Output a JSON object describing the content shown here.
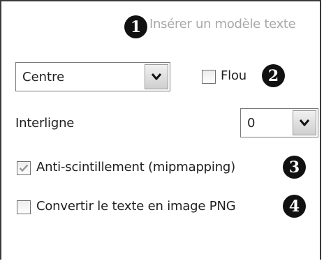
{
  "link": {
    "badge": "1",
    "text": "Insérer un modèle texte"
  },
  "alignment": {
    "value": "Centre"
  },
  "blur": {
    "label": "Flou",
    "badge": "2",
    "checked": false
  },
  "line_spacing": {
    "label": "Interligne",
    "value": "0"
  },
  "anti_flicker": {
    "label": "Anti-scintillement (mipmapping)",
    "badge": "3",
    "checked": true,
    "disabled": true
  },
  "png_convert": {
    "label": "Convertir le texte en image PNG",
    "badge": "4",
    "checked": false
  },
  "colors": {
    "badge_bg": "#111111",
    "link_text": "#a8a8a8",
    "disabled_check": "#9a9a9a"
  },
  "icons": [
    "chevron-down-icon",
    "checkmark-icon"
  ]
}
